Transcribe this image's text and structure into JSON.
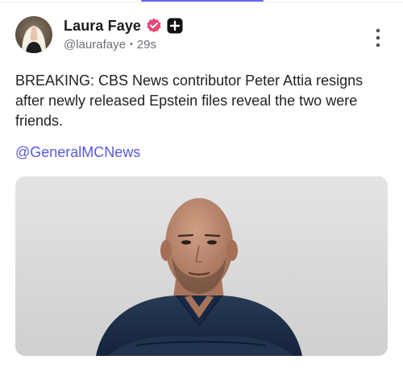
{
  "post": {
    "author": {
      "display_name": "Laura Faye",
      "handle": "@laurafaye",
      "time_ago": "29s"
    },
    "separator": "•",
    "text": "BREAKING: CBS News contributor Peter Attia resigns after newly released Epstein files reveal the two were friends.",
    "mention": "@GeneralMCNews"
  },
  "icons": {
    "verified": "verified-badge-icon",
    "plus": "plus-badge-icon",
    "more": "more-options-icon"
  },
  "colors": {
    "accent": "#5b57e0",
    "verified": "#e8477a",
    "tab_indicator": "#6b63f6"
  }
}
